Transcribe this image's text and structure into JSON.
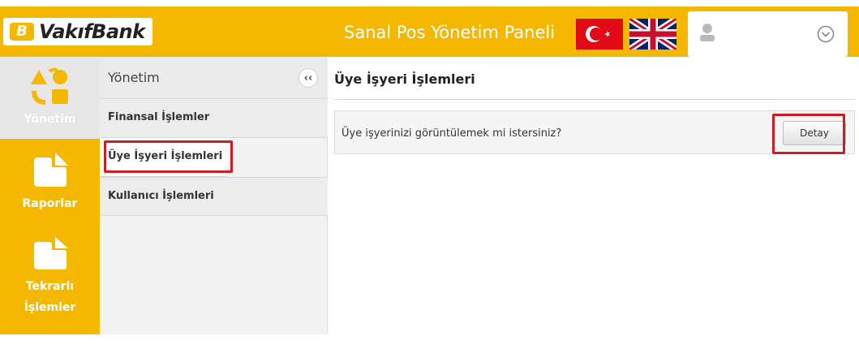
{
  "header": {
    "logo_text": "VakıfBank",
    "logo_mark": "B",
    "panel_title": "Sanal Pos Yönetim Paneli",
    "flags": [
      "turkish-flag-icon",
      "uk-flag-icon"
    ],
    "user_icon": "user-icon",
    "menu_icon": "chevron-down-circle-icon"
  },
  "sidebar": {
    "items": [
      {
        "label": "Yönetim",
        "icon": "management-icon",
        "active": true
      },
      {
        "label": "Raporlar",
        "icon": "reports-icon",
        "active": false
      },
      {
        "label": "Tekrarlı\nİşlemler",
        "label_line1": "Tekrarlı",
        "label_line2": "İşlemler",
        "icon": "recurring-icon",
        "active": false
      }
    ]
  },
  "submenu": {
    "title": "Yönetim",
    "collapse_label": "‹‹",
    "items": [
      {
        "label": "Finansal İşlemler"
      },
      {
        "label": "Üye İşyeri İşlemleri",
        "active": true
      },
      {
        "label": "Kullanıcı İşlemleri"
      }
    ]
  },
  "content": {
    "title": "Üye İşyeri İşlemleri",
    "question": "Üye işyerinizi görüntülemek mi istersiniz?",
    "detail_button": "Detay"
  },
  "colors": {
    "brand_yellow": "#f5b800",
    "highlight_red": "#cc1d23"
  }
}
